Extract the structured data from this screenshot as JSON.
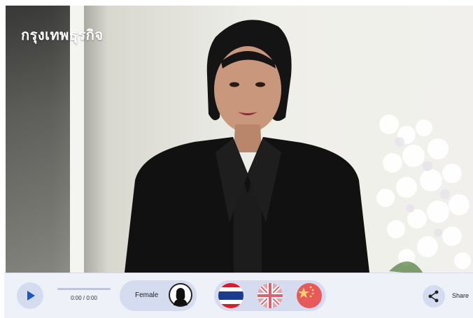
{
  "video": {
    "watermark": "กรุงเทพธุรกิจ"
  },
  "player": {
    "play_icon": "play-icon",
    "time": "0:00 / 0:00",
    "progress": 0,
    "voice_label": "Female",
    "voice_icon": "female-avatar-icon",
    "languages": [
      {
        "icon": "thailand-flag-icon"
      },
      {
        "icon": "uk-flag-icon"
      },
      {
        "icon": "china-flag-icon"
      }
    ],
    "share_icon": "share-icon",
    "share_label": "Share"
  },
  "colors": {
    "accent": "#1a55c9",
    "pill": "#d6dcf0",
    "bar": "#eef1f8"
  }
}
